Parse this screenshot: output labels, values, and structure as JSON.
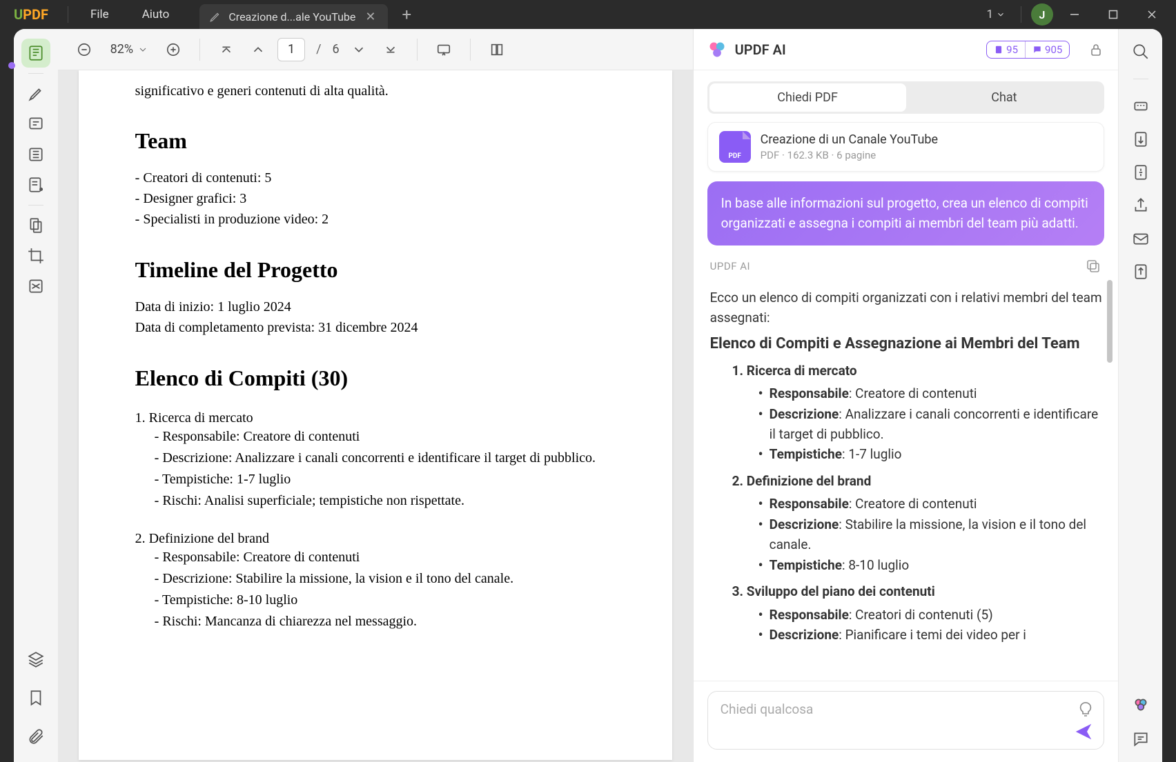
{
  "app": {
    "logo_u": "U",
    "logo_pdf": "PDF"
  },
  "menu": {
    "file": "File",
    "help": "Aiuto"
  },
  "tab": {
    "title": "Creazione d...ale YouTube"
  },
  "win": {
    "count": "1",
    "avatar": "J"
  },
  "toolbar": {
    "zoom": "82%",
    "page_current": "1",
    "page_total": "6"
  },
  "doc": {
    "intro_fragment": "significativo e generi contenuti di alta qualità.",
    "team_h": "Team",
    "team_lines": [
      "- Creatori di contenuti: 5",
      "- Designer grafici: 3",
      "- Specialisti in produzione video: 2"
    ],
    "timeline_h": "Timeline del Progetto",
    "timeline_lines": [
      "Data di inizio: 1 luglio 2024",
      "Data di completamento prevista: 31 dicembre 2024"
    ],
    "tasks_h": "Elenco di Compiti (30)",
    "tasks": [
      {
        "title": "1. Ricerca di mercato",
        "lines": [
          "- Responsabile: Creatore di contenuti",
          "- Descrizione: Analizzare i canali concorrenti e identificare il target di pubblico.",
          "- Tempistiche: 1-7 luglio",
          "- Rischi: Analisi superficiale; tempistiche non rispettate."
        ]
      },
      {
        "title": "2. Definizione del brand",
        "lines": [
          "- Responsabile: Creatore di contenuti",
          "- Descrizione: Stabilire la missione, la vision e il tono del canale.",
          "- Tempistiche: 8-10 luglio",
          "- Rischi: Mancanza di chiarezza nel messaggio."
        ]
      }
    ]
  },
  "ai": {
    "title": "UPDF AI",
    "badge1": "95",
    "badge2": "905",
    "tab1": "Chiedi PDF",
    "tab2": "Chat",
    "file_name": "Creazione di un Canale YouTube",
    "file_meta_type": "PDF",
    "file_meta_size": "162.3 KB",
    "file_meta_pages": "6 pagine",
    "prompt": "In base alle informazioni sul progetto, crea un elenco di compiti organizzati e assegna i compiti ai membri del team più adatti.",
    "label": "UPDF AI",
    "resp_intro": "Ecco un elenco di compiti organizzati con i relativi membri del team assegnati:",
    "resp_h": "Elenco di Compiti e Assegnazione ai Membri del Team",
    "labels": {
      "resp": "Responsabile",
      "desc": "Descrizione",
      "time": "Tempistiche"
    },
    "items": [
      {
        "n": "1.",
        "title": "Ricerca di mercato",
        "resp": "Creatore di contenuti",
        "desc": "Analizzare i canali concorrenti e identificare il target di pubblico.",
        "time": "1-7 luglio"
      },
      {
        "n": "2.",
        "title": "Definizione del brand",
        "resp": "Creatore di contenuti",
        "desc": "Stabilire la missione, la vision e il tono del canale.",
        "time": "8-10 luglio"
      },
      {
        "n": "3.",
        "title": "Sviluppo del piano dei contenuti",
        "resp": "Creatori di contenuti (5)",
        "desc": "Pianificare i temi dei video per i",
        "time": ""
      }
    ],
    "input_placeholder": "Chiedi qualcosa"
  }
}
